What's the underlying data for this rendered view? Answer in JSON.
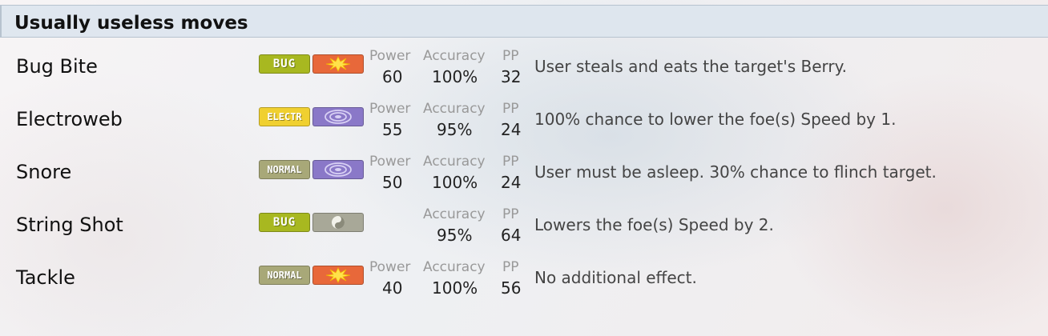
{
  "section": {
    "title": "Usually useless moves"
  },
  "colors": {
    "bug": "#a8b820",
    "electric": "#f0d030",
    "normal": "#a8a878",
    "physical": "#e8683a",
    "special": "#8a78c8",
    "status": "#9a9a8a"
  },
  "moves": [
    {
      "name": "Bug Bite",
      "type": "BUG",
      "type_color": "bug",
      "category": "physical-icon",
      "power_label": "Power",
      "power": "60",
      "accuracy_label": "Accuracy",
      "accuracy": "100%",
      "pp_label": "PP",
      "pp": "32",
      "description": "User steals and eats the target's Berry."
    },
    {
      "name": "Electroweb",
      "type": "ELECTR",
      "type_color": "electric",
      "category": "special-icon",
      "power_label": "Power",
      "power": "55",
      "accuracy_label": "Accuracy",
      "accuracy": "95%",
      "pp_label": "PP",
      "pp": "24",
      "description": "100% chance to lower the foe(s) Speed by 1."
    },
    {
      "name": "Snore",
      "type": "NORMAL",
      "type_color": "normal",
      "category": "special-icon",
      "power_label": "Power",
      "power": "50",
      "accuracy_label": "Accuracy",
      "accuracy": "100%",
      "pp_label": "PP",
      "pp": "24",
      "description": "User must be asleep. 30% chance to flinch target."
    },
    {
      "name": "String Shot",
      "type": "BUG",
      "type_color": "bug",
      "category": "status-icon",
      "accuracy_label": "Accuracy",
      "accuracy": "95%",
      "pp_label": "PP",
      "pp": "64",
      "description": "Lowers the foe(s) Speed by 2."
    },
    {
      "name": "Tackle",
      "type": "NORMAL",
      "type_color": "normal",
      "category": "physical-icon",
      "power_label": "Power",
      "power": "40",
      "accuracy_label": "Accuracy",
      "accuracy": "100%",
      "pp_label": "PP",
      "pp": "56",
      "description": "No additional effect."
    }
  ]
}
